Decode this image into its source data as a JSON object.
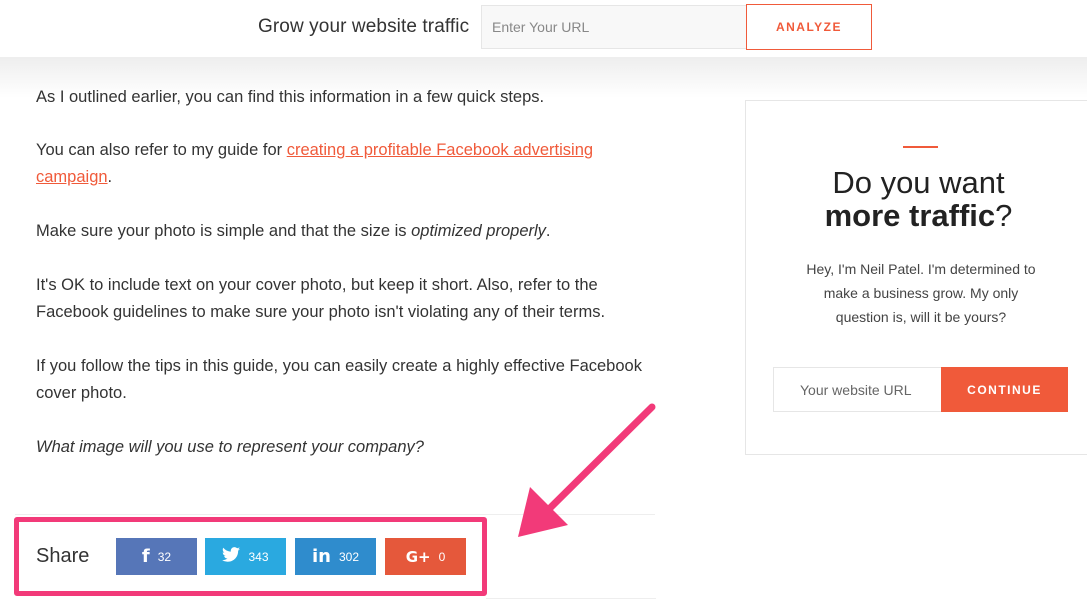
{
  "header": {
    "title": "Grow your website traffic",
    "url_placeholder": "Enter Your URL",
    "analyze_label": "ANALYZE"
  },
  "article": {
    "p1": "As I outlined earlier, you can find this information in a few quick steps.",
    "p2_prefix": "You can also refer to my guide for ",
    "p2_link": "creating a profitable Facebook advertising campaign",
    "p2_suffix": ".",
    "p3_prefix": "Make sure your photo is simple and that the size is ",
    "p3_em": "optimized properly",
    "p3_suffix": ".",
    "p4": "It's OK to include text on your cover photo, but keep it short. Also, refer to the Facebook guidelines to make sure your photo isn't violating any of their terms.",
    "p5": "If you follow the tips in this guide, you can easily create a highly effective Facebook cover photo.",
    "p6": "What image will you use to represent your company?"
  },
  "share": {
    "label": "Share",
    "buttons": [
      {
        "icon": "facebook-icon",
        "glyph": "f",
        "count": "32",
        "color": "#5676b8"
      },
      {
        "icon": "twitter-icon",
        "glyph": "🐦",
        "count": "343",
        "color": "#2aa9e0"
      },
      {
        "icon": "linkedin-icon",
        "glyph": "in",
        "count": "302",
        "color": "#2f8ccd"
      },
      {
        "icon": "google-plus-icon",
        "glyph": "G+",
        "count": "0",
        "color": "#e5583b"
      }
    ]
  },
  "annotation": {
    "highlight_color": "#f23a79"
  },
  "sidebar": {
    "heading_line1": "Do you want",
    "heading_bold": "more traffic",
    "heading_mark": "?",
    "body": "Hey, I'm Neil Patel. I'm determined to make a business grow. My only question is, will it be yours?",
    "url_placeholder": "Your website URL",
    "continue_label": "CONTINUE"
  },
  "colors": {
    "accent": "#f05a3a"
  }
}
